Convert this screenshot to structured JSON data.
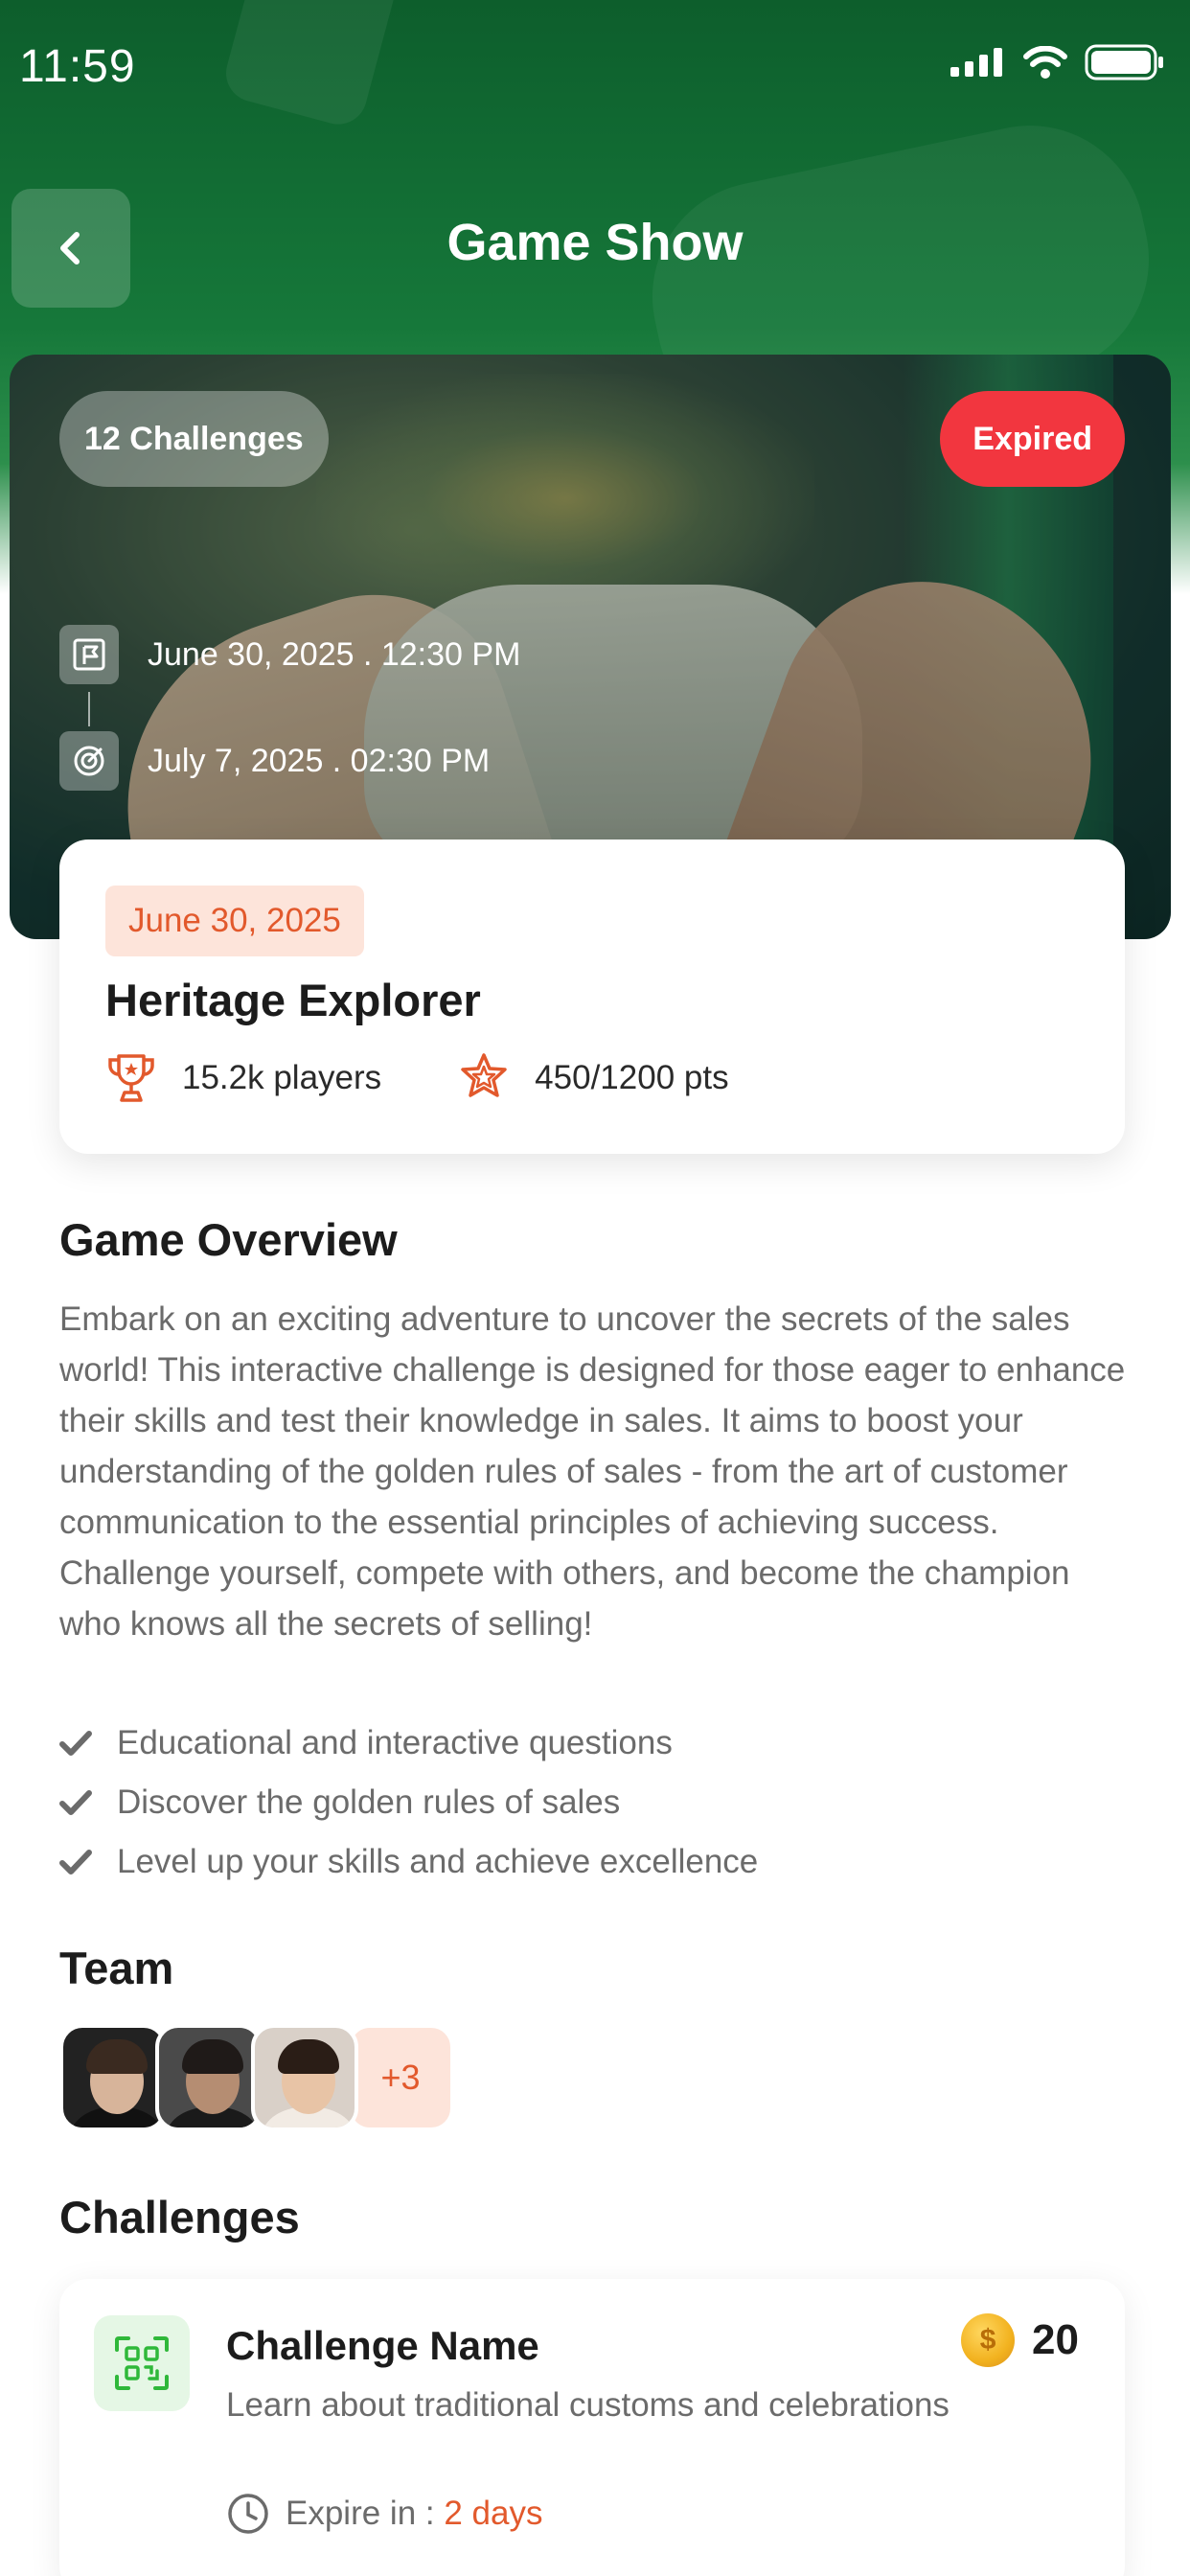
{
  "status_bar": {
    "time": "11:59"
  },
  "header": {
    "title": "Game Show"
  },
  "cover": {
    "challenges_count": "12 Challenges",
    "status": "Expired",
    "start_datetime": "June 30, 2025 . 12:30 PM",
    "end_datetime": "July 7, 2025 . 02:30 PM"
  },
  "game_card": {
    "date": "June 30, 2025",
    "title": "Heritage Explorer",
    "players": "15.2k players",
    "points": "450/1200 pts"
  },
  "overview": {
    "title": "Game Overview",
    "description": "Embark on an exciting adventure to uncover the secrets of the sales world! This interactive challenge is designed for those eager to enhance their skills and test their knowledge in sales. It aims to boost your understanding of the golden rules of sales - from the art of customer communication to the essential principles of achieving success. Challenge yourself, compete with others, and become the champion who knows all the secrets of selling!",
    "features": [
      "Educational and interactive questions",
      "Discover the golden rules of sales",
      "Level up your skills and achieve excellence"
    ]
  },
  "team": {
    "title": "Team",
    "more_count": "+3"
  },
  "challenges": {
    "title": "Challenges",
    "items": [
      {
        "name": "Challenge Name",
        "description": "Learn about traditional customs and celebrations",
        "coins": "20",
        "coin_symbol": "$",
        "expire_label": "Expire in : ",
        "expire_value": "2 days"
      }
    ]
  },
  "colors": {
    "header_green": "#16783a",
    "expired_red": "#f2363f",
    "accent_orange": "#e2592c",
    "badge_peach": "#fde4da"
  }
}
